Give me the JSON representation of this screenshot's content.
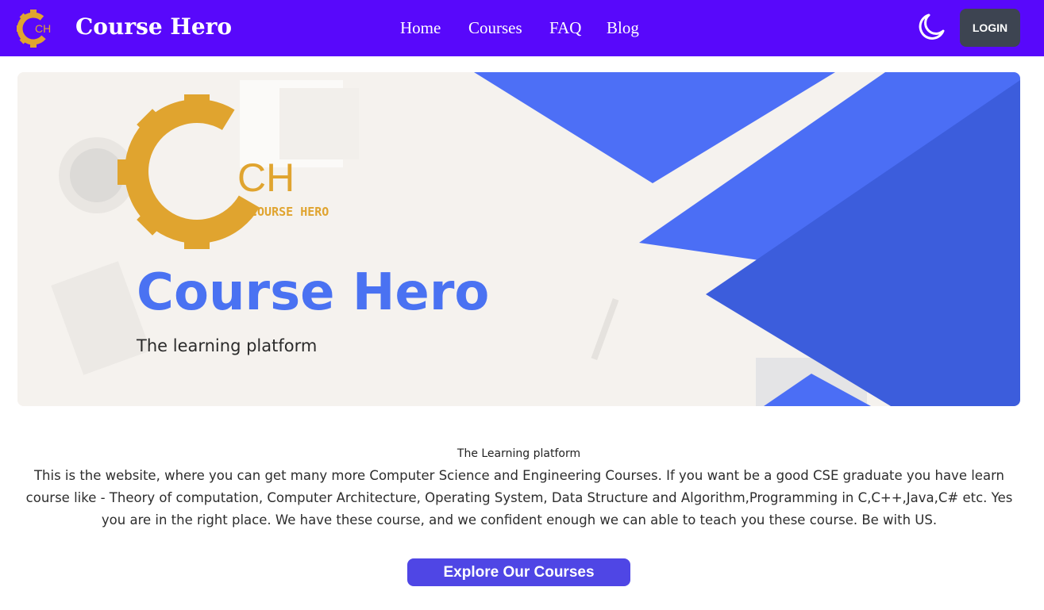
{
  "header": {
    "brand": "Course Hero",
    "logo_text": "CH",
    "nav": [
      "Home",
      "Courses",
      "FAQ",
      "Blog"
    ],
    "theme_icon": "moon-icon",
    "login_label": "LOGIN"
  },
  "banner": {
    "logo_letters": "CH",
    "logo_caption": "COURSE HERO",
    "title": "Course Hero",
    "subtitle": "The learning platform"
  },
  "content": {
    "tagline": "The Learning platform",
    "description": "This is the website, where you can get many more Computer Science and Engineering Courses. If you want be a good CSE graduate you have learn course like - Theory of computation, Computer Architecture, Operating System, Data Structure and Algorithm,Programming in C,C++,Java,C# etc. Yes you are in the right place. We have these course, and we confident enough we can able to teach you these course. Be with US.",
    "explore_label": "Explore Our Courses"
  },
  "colors": {
    "nav_bg": "#5808fb",
    "accent_blue": "#4a72f2",
    "logo_gold": "#e0a42f",
    "login_bg": "#3d4451",
    "button_bg": "#4f46e5"
  }
}
